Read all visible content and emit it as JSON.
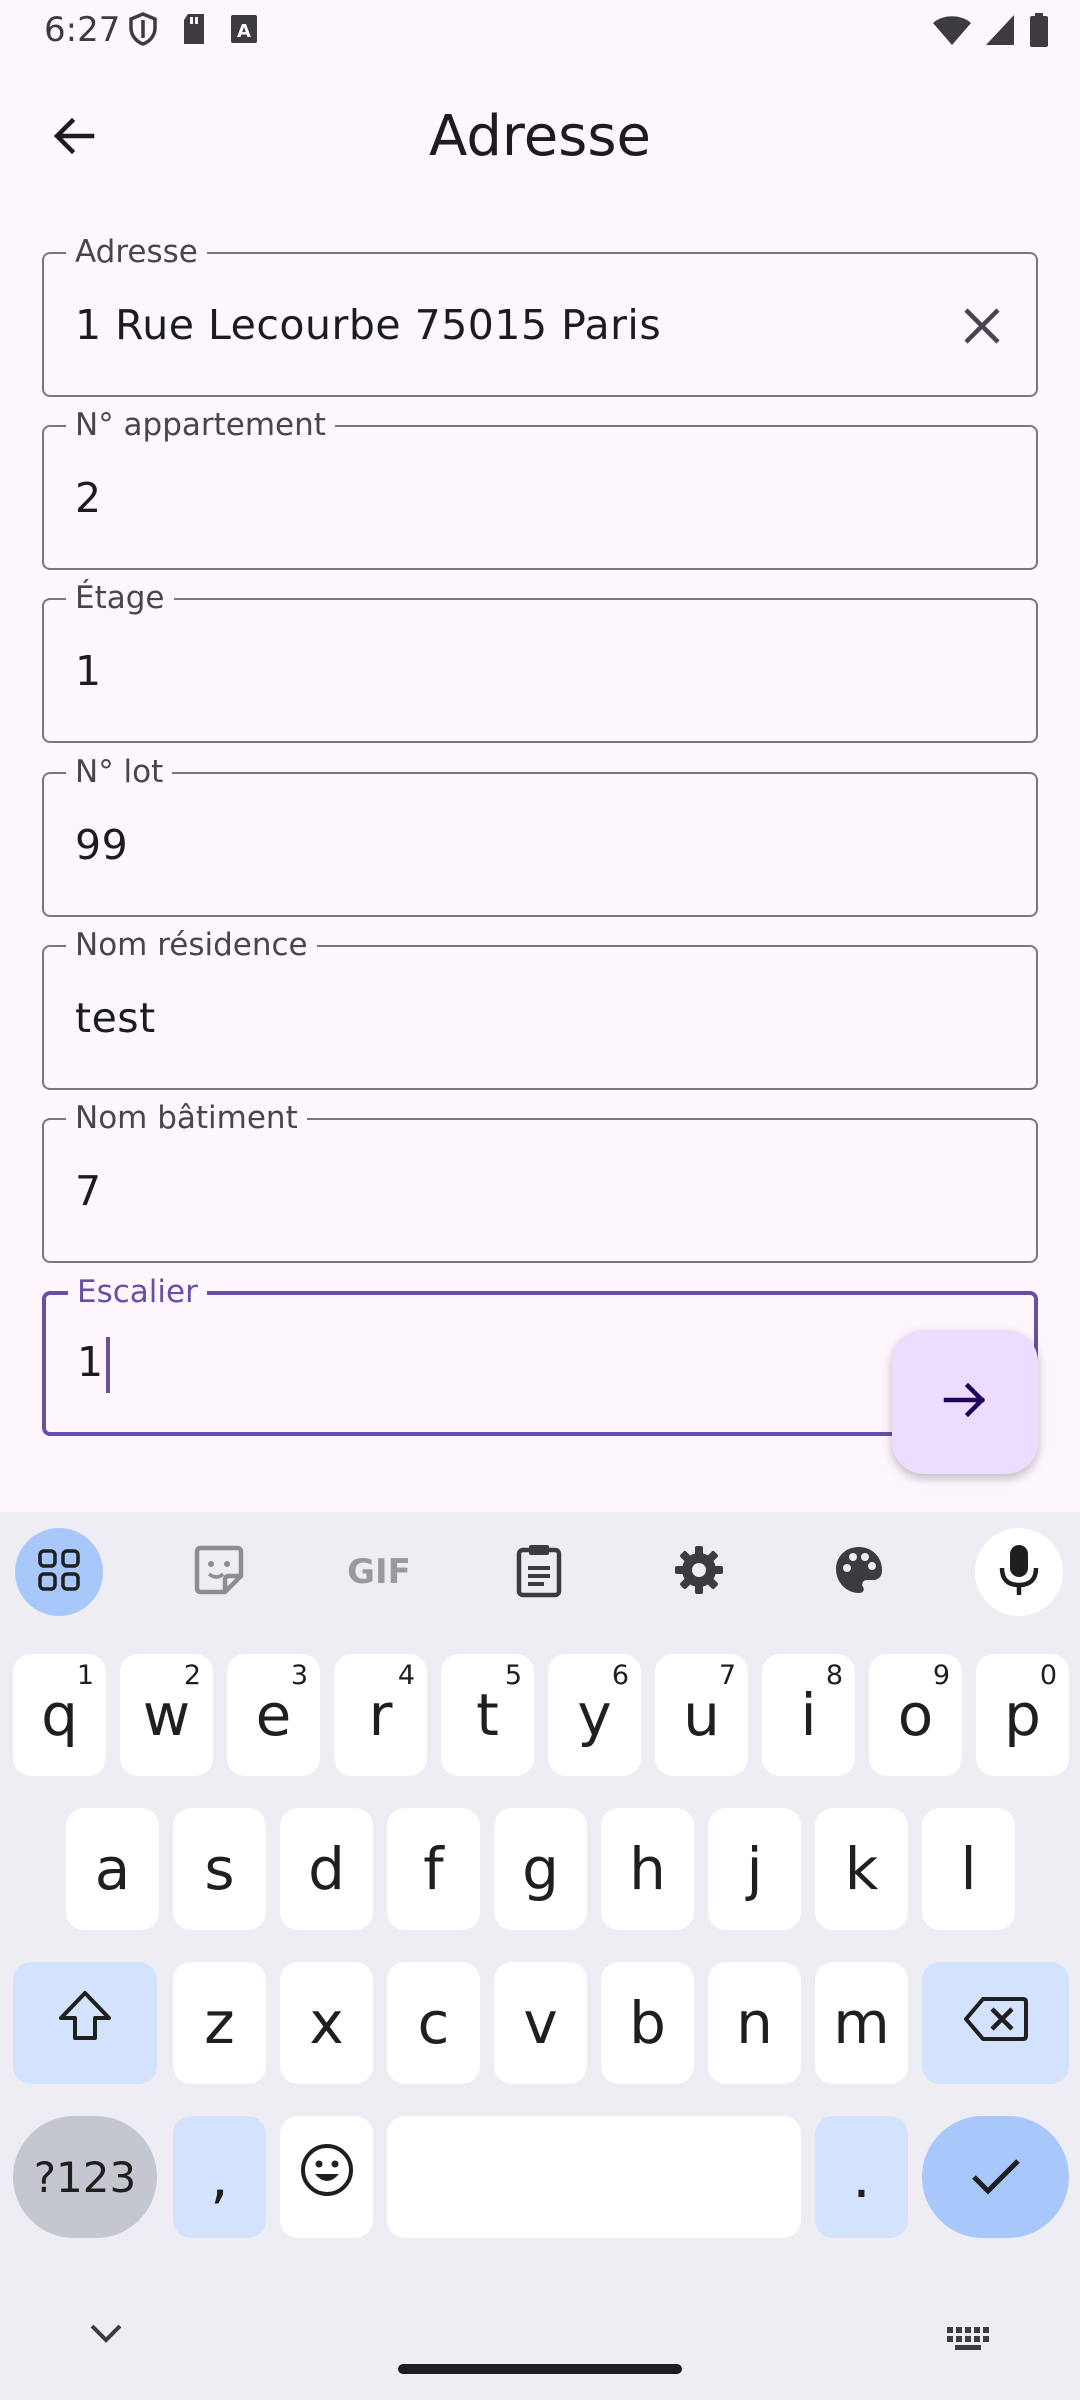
{
  "status_bar": {
    "time": "6:27"
  },
  "app_bar": {
    "title": "Adresse"
  },
  "fields": [
    {
      "label": "Adresse",
      "value": "1 Rue Lecourbe 75015 Paris"
    },
    {
      "label": "N° appartement",
      "value": "2"
    },
    {
      "label": "Étage",
      "value": "1"
    },
    {
      "label": "N° lot",
      "value": "99"
    },
    {
      "label": "Nom résidence",
      "value": "test"
    },
    {
      "label": "Nom bâtiment",
      "value": "7"
    },
    {
      "label": "Escalier",
      "value": "1"
    }
  ],
  "keyboard": {
    "toolbar": {
      "gif_label": "GIF"
    },
    "row1": [
      {
        "key": "q",
        "hint": "1"
      },
      {
        "key": "w",
        "hint": "2"
      },
      {
        "key": "e",
        "hint": "3"
      },
      {
        "key": "r",
        "hint": "4"
      },
      {
        "key": "t",
        "hint": "5"
      },
      {
        "key": "y",
        "hint": "6"
      },
      {
        "key": "u",
        "hint": "7"
      },
      {
        "key": "i",
        "hint": "8"
      },
      {
        "key": "o",
        "hint": "9"
      },
      {
        "key": "p",
        "hint": "0"
      }
    ],
    "row2": [
      "a",
      "s",
      "d",
      "f",
      "g",
      "h",
      "j",
      "k",
      "l"
    ],
    "row3": [
      "z",
      "x",
      "c",
      "v",
      "b",
      "n",
      "m"
    ],
    "symbols_label": "?123",
    "comma_label": ",",
    "period_label": "."
  },
  "colors": {
    "background": "#FDF7FD",
    "accent": "#6750A4",
    "fab_background": "#EADDFF",
    "keyboard_background": "#EEEDF4"
  }
}
